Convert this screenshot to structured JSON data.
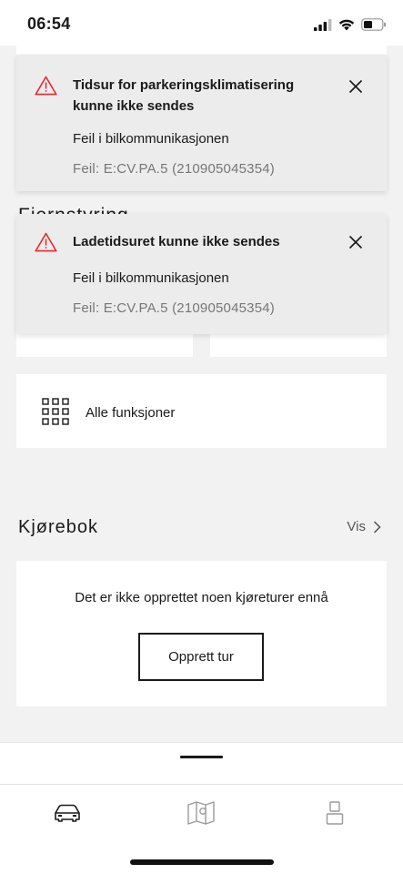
{
  "status_bar": {
    "time": "06:54",
    "icons": [
      "signal-icon",
      "wifi-icon",
      "battery-icon"
    ]
  },
  "background_section": {
    "partial_heading": "Fjernstyring"
  },
  "notifications": [
    {
      "title": "Tidsur for parkeringsklimatisering kunne ikke sendes",
      "message": "Feil i bilkommunikasjonen",
      "code": "Feil: E:CV.PA.5 (210905045354)",
      "icon": "warning-triangle-icon"
    },
    {
      "title": "Ladetidsuret kunne ikke sendes",
      "message": "Feil i bilkommunikasjonen",
      "code": "Feil: E:CV.PA.5 (210905045354)",
      "icon": "warning-triangle-icon"
    }
  ],
  "all_functions": {
    "label": "Alle funksjoner",
    "icon": "grid-icon"
  },
  "logbook": {
    "title": "Kjørebok",
    "link_label": "Vis",
    "empty_text": "Det er ikke opprettet noen kjøreturer ennå",
    "button_label": "Opprett tur"
  },
  "tab_bar": {
    "tabs": [
      {
        "icon": "car-icon",
        "active": true
      },
      {
        "icon": "map-icon",
        "active": false
      },
      {
        "icon": "profile-icon",
        "active": false
      }
    ]
  },
  "colors": {
    "warning": "#e8282e",
    "text": "#1a1a1a",
    "muted": "#777777",
    "notification_bg": "#ececec",
    "page_bg": "#f2f2f2"
  }
}
